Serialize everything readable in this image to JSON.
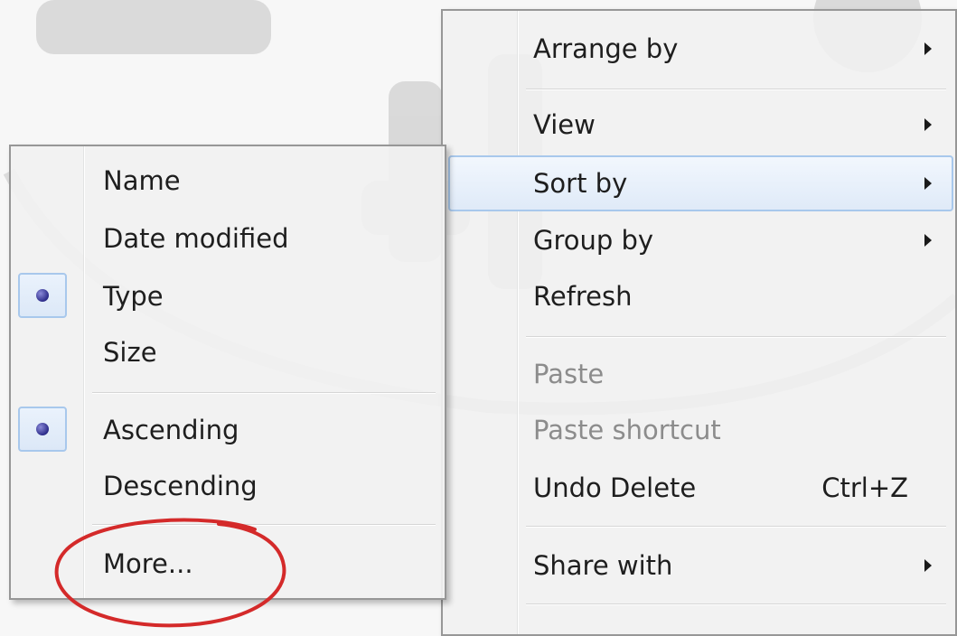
{
  "context_menu": {
    "items": [
      {
        "label": "Arrange by",
        "has_submenu": true,
        "enabled": true
      },
      {
        "label": "View",
        "has_submenu": true,
        "enabled": true
      },
      {
        "label": "Sort by",
        "has_submenu": true,
        "enabled": true,
        "highlighted": true
      },
      {
        "label": "Group by",
        "has_submenu": true,
        "enabled": true
      },
      {
        "label": "Refresh",
        "has_submenu": false,
        "enabled": true
      },
      {
        "label": "Paste",
        "has_submenu": false,
        "enabled": false
      },
      {
        "label": "Paste shortcut",
        "has_submenu": false,
        "enabled": false
      },
      {
        "label": "Undo Delete",
        "shortcut": "Ctrl+Z",
        "has_submenu": false,
        "enabled": true
      },
      {
        "label": "Share with",
        "has_submenu": true,
        "enabled": true
      }
    ]
  },
  "sort_submenu": {
    "items": [
      {
        "label": "Name",
        "selected": false
      },
      {
        "label": "Date modified",
        "selected": false
      },
      {
        "label": "Type",
        "selected": true
      },
      {
        "label": "Size",
        "selected": false
      },
      {
        "label": "Ascending",
        "selected": true
      },
      {
        "label": "Descending",
        "selected": false
      },
      {
        "label": "More...",
        "selected": false,
        "annotated": true
      }
    ]
  },
  "colors": {
    "highlight_border": "#a8c8ec",
    "annotation_red": "#d42a2a",
    "disabled_text": "#8c8c8c",
    "menu_border": "#979797"
  }
}
